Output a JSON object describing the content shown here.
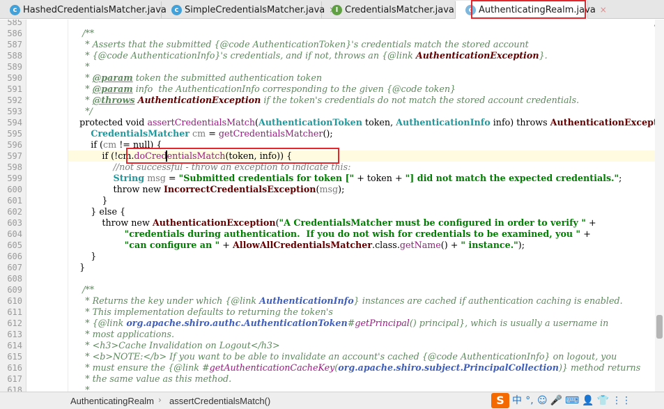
{
  "tabs": [
    {
      "label": "HashedCredentialsMatcher.java",
      "icon": "class-icon",
      "icon_letter": "c",
      "active": false
    },
    {
      "label": "SimpleCredentialsMatcher.java",
      "icon": "class-icon",
      "icon_letter": "c",
      "active": false
    },
    {
      "label": "CredentialsMatcher.java",
      "icon": "interface-icon",
      "icon_letter": "I",
      "active": false
    },
    {
      "label": "AuthenticatingRealm.java",
      "icon": "abstract-class-icon",
      "icon_letter": "c",
      "active": true
    }
  ],
  "tab_close_glyph": "×",
  "editor": {
    "line_numbers": [
      "585",
      "586",
      "587",
      "588",
      "589",
      "590",
      "591",
      "592",
      "593",
      "594",
      "595",
      "596",
      "597",
      "598",
      "599",
      "600",
      "601",
      "602",
      "603",
      "604",
      "605",
      "606",
      "607",
      "608",
      "609",
      "610",
      "611",
      "612",
      "613",
      "614",
      "615",
      "616",
      "617",
      "618"
    ],
    "highlighted_line": "597",
    "highlighted_call": "doCredentialsMatch",
    "status_check": "✓"
  },
  "breadcrumb": {
    "class_name": "AuthenticatingRealm",
    "method_name": "assertCredentialsMatch()",
    "separator": "›"
  },
  "ime_tray": [
    "中",
    "°,",
    "☺",
    "🎤",
    "⌨",
    "👤",
    "👕",
    "⋮⋮"
  ],
  "ime_logo": "S",
  "colors": {
    "highlight_box": "#e3262c",
    "javadoc": "#5c8a5c",
    "keyword": "#000080",
    "type": "#20999d",
    "method_call": "#9b1a83",
    "string": "#008000"
  }
}
